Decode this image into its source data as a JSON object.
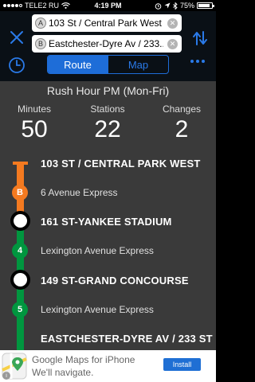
{
  "status_bar": {
    "carrier": "TELE2 RU",
    "time": "4:19 PM",
    "battery": "75%",
    "battery_level": 0.75
  },
  "header": {
    "from": {
      "tag": "A",
      "text": "103 St / Central Park West"
    },
    "to": {
      "tag": "B",
      "text": "Eastchester-Dyre Av / 233..."
    },
    "tabs": [
      {
        "label": "Route",
        "active": true
      },
      {
        "label": "Map",
        "active": false
      }
    ]
  },
  "summary": {
    "schedule": "Rush Hour PM (Mon-Fri)",
    "minutes_label": "Minutes",
    "minutes_value": "50",
    "stations_label": "Stations",
    "stations_value": "22",
    "changes_label": "Changes",
    "changes_value": "2"
  },
  "route": {
    "stops": [
      "103 ST / CENTRAL PARK WEST",
      "161 ST-YANKEE STADIUM",
      "149 ST-GRAND CONCOURSE",
      "EASTCHESTER-DYRE AV / 233 ST"
    ],
    "services": [
      {
        "bullet": "B",
        "name": "6 Avenue Express",
        "color": "#f47a20"
      },
      {
        "bullet": "4",
        "name": "Lexington Avenue Express",
        "color": "#00963f"
      },
      {
        "bullet": "5",
        "name": "Lexington Avenue Express",
        "color": "#00963f"
      }
    ]
  },
  "ad": {
    "line1": "Google Maps for iPhone",
    "line2": "We'll navigate.",
    "install": "Install"
  },
  "colors": {
    "accent": "#1e6dd8",
    "b_line": "#f47a20",
    "lex_line": "#00963f"
  }
}
